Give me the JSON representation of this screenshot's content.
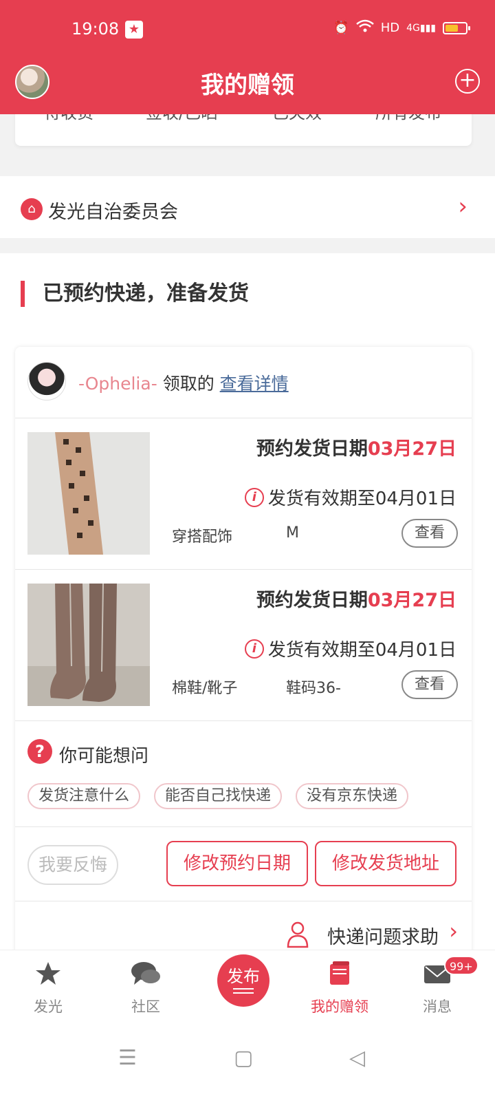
{
  "status_bar": {
    "time": "19:08",
    "network": "HD",
    "signal": "4G"
  },
  "header": {
    "title": "我的赠领",
    "add_icon": "plus-circle-icon"
  },
  "top_tabs": [
    "待收货",
    "签收/已晒",
    "已失效",
    "所有发布"
  ],
  "committee": {
    "label": "发光自治委员会"
  },
  "section": {
    "title": "已预约快递，准备发货"
  },
  "order": {
    "claimer_name": "-Ophelia-",
    "claimed_text": "领取的",
    "detail_link": "查看详情",
    "items": [
      {
        "ship_label": "预约发货日期",
        "ship_date": "03月27日",
        "valid_until": "发货有效期至04月01日",
        "category": "穿搭配饰",
        "size": "M",
        "view": "查看"
      },
      {
        "ship_label": "预约发货日期",
        "ship_date": "03月27日",
        "valid_until": "发货有效期至04月01日",
        "category": "棉鞋/靴子",
        "size": "鞋码36-",
        "view": "查看"
      }
    ],
    "faq": {
      "title": "你可能想问",
      "chips": [
        "发货注意什么",
        "能否自己找快递",
        "没有京东快递"
      ]
    },
    "actions": {
      "regret": "我要反悔",
      "change_date": "修改预约日期",
      "change_address": "修改发货地址"
    },
    "help": {
      "label": "快递问题求助"
    }
  },
  "bottom_nav": {
    "items": [
      {
        "label": "发光",
        "icon": "star-icon"
      },
      {
        "label": "社区",
        "icon": "chat-bubbles-icon"
      },
      {
        "label": "我的赠领",
        "icon": "gift-book-icon",
        "active": true
      },
      {
        "label": "消息",
        "icon": "mail-icon",
        "badge": "99+"
      }
    ],
    "publish": "发布"
  },
  "colors": {
    "accent": "#e63e50"
  }
}
